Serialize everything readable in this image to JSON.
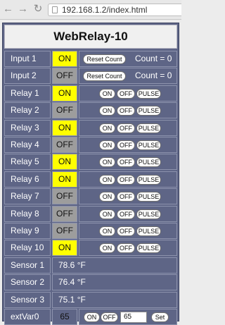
{
  "browser": {
    "url": "192.168.1.2/index.html",
    "back": "←",
    "forward": "→",
    "reload": "↻"
  },
  "title": "WebRelay-10",
  "inputs": [
    {
      "label": "Input 1",
      "state": "ON",
      "reset": "Reset Count",
      "count_text": "Count = 0"
    },
    {
      "label": "Input 2",
      "state": "OFF",
      "reset": "Reset Count",
      "count_text": "Count = 0"
    }
  ],
  "relays": [
    {
      "label": "Relay 1",
      "state": "ON"
    },
    {
      "label": "Relay 2",
      "state": "OFF"
    },
    {
      "label": "Relay 3",
      "state": "ON"
    },
    {
      "label": "Relay 4",
      "state": "OFF"
    },
    {
      "label": "Relay 5",
      "state": "ON"
    },
    {
      "label": "Relay 6",
      "state": "ON"
    },
    {
      "label": "Relay 7",
      "state": "OFF"
    },
    {
      "label": "Relay 8",
      "state": "OFF"
    },
    {
      "label": "Relay 9",
      "state": "OFF"
    },
    {
      "label": "Relay 10",
      "state": "ON"
    }
  ],
  "relay_buttons": {
    "on": "ON",
    "off": "OFF",
    "pulse": "PULSE"
  },
  "sensors": [
    {
      "label": "Sensor 1",
      "value": "78.6 °F"
    },
    {
      "label": "Sensor 2",
      "value": "76.4 °F"
    },
    {
      "label": "Sensor 3",
      "value": "75.1 °F"
    }
  ],
  "extvar": {
    "label": "extVar0",
    "value": "65",
    "on": "ON",
    "off": "OFF",
    "input_value": "65",
    "set": "Set"
  },
  "colors": {
    "on_state": "#ffff00",
    "off_state": "#9d9d9d",
    "panel": "#5e6586"
  }
}
